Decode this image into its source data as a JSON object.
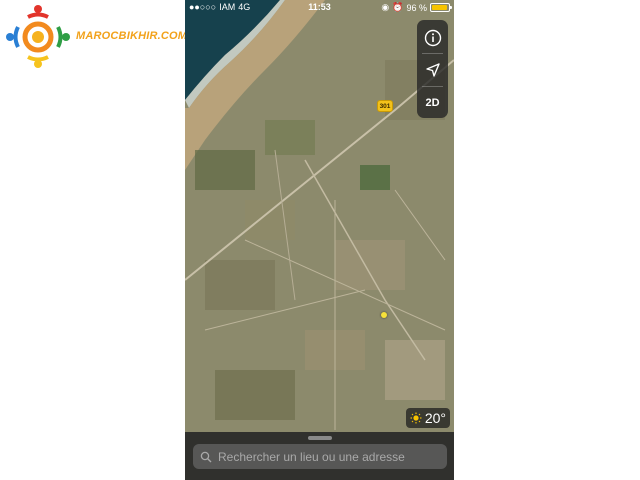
{
  "watermark": {
    "site": "MAROCBIKHIR.COM"
  },
  "statusbar": {
    "carrier": "IAM",
    "network": "4G",
    "time": "11:53",
    "battery_text": "96 %",
    "battery_level": 0.96
  },
  "map_controls": {
    "info_icon": "info-icon",
    "locate_icon": "location-arrow-icon",
    "mode_label": "2D"
  },
  "map": {
    "route_number": "301"
  },
  "weather": {
    "icon": "sun-icon",
    "temperature": "20°"
  },
  "search": {
    "placeholder": "Rechercher un lieu ou une adresse",
    "icon": "search-icon"
  }
}
